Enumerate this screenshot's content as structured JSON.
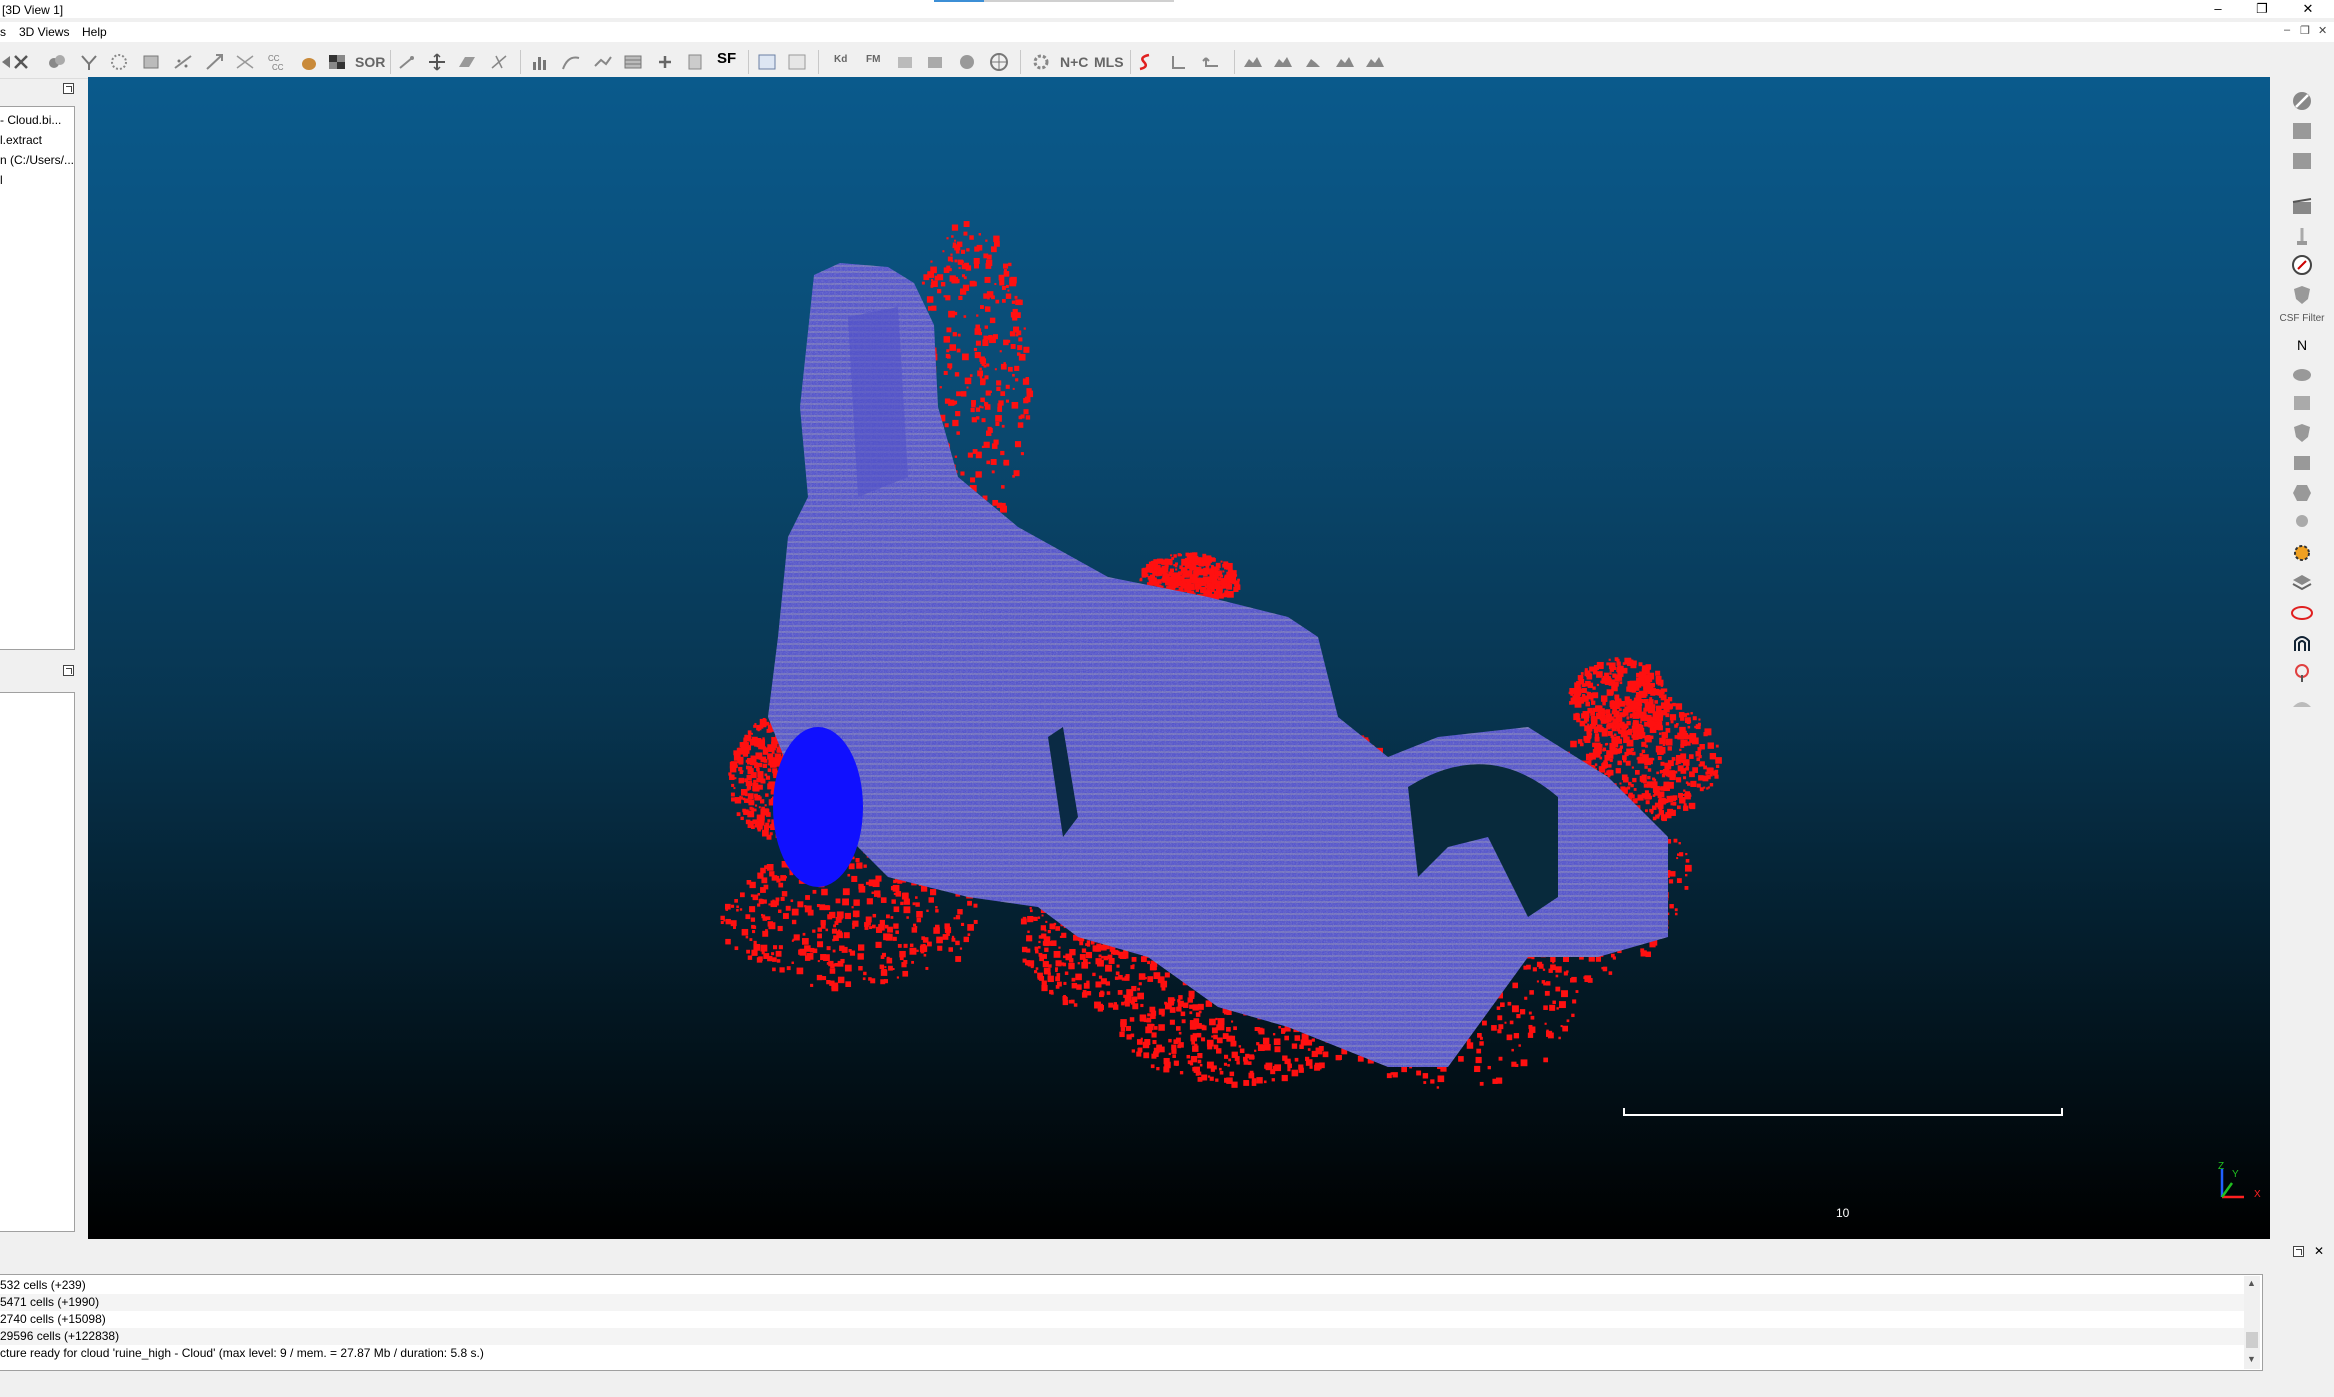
{
  "window": {
    "title": "[3D View 1]",
    "controls": {
      "minimize": "–",
      "restore": "❐",
      "close": "✕"
    },
    "mdi_controls": {
      "minimize": "–",
      "restore": "❐",
      "close": "✕"
    }
  },
  "menu": {
    "items": [
      "s",
      "3D Views",
      "Help"
    ]
  },
  "toolbar": {
    "text_buttons": {
      "sor": "SOR",
      "sf": "SF",
      "nc": "N+C",
      "mls": "MLS",
      "kd": "Kd",
      "fm": "FM"
    }
  },
  "db_tree": {
    "items": [
      "- Cloud.bi...",
      "l.extract",
      "n (C:/Users/...",
      "l"
    ]
  },
  "right_toolbar": {
    "csf_label": "CSF Filter",
    "north_label": "N"
  },
  "view3d": {
    "scale_label": "10",
    "axis": {
      "z": "Z",
      "y": "Y",
      "x": "X"
    }
  },
  "console": {
    "lines": [
      "532 cells (+239)",
      "5471 cells (+1990)",
      "2740 cells (+15098)",
      "29596 cells (+122838)",
      "cture ready for cloud 'ruine_high - Cloud' (max level: 9 / mem. = 27.87 Mb / duration: 5.8 s.)"
    ]
  },
  "colors": {
    "sky_top": "#0a5a8c",
    "sky_bottom": "#000000",
    "points_blue": "#3a3ad8",
    "points_red": "#ff1010"
  }
}
